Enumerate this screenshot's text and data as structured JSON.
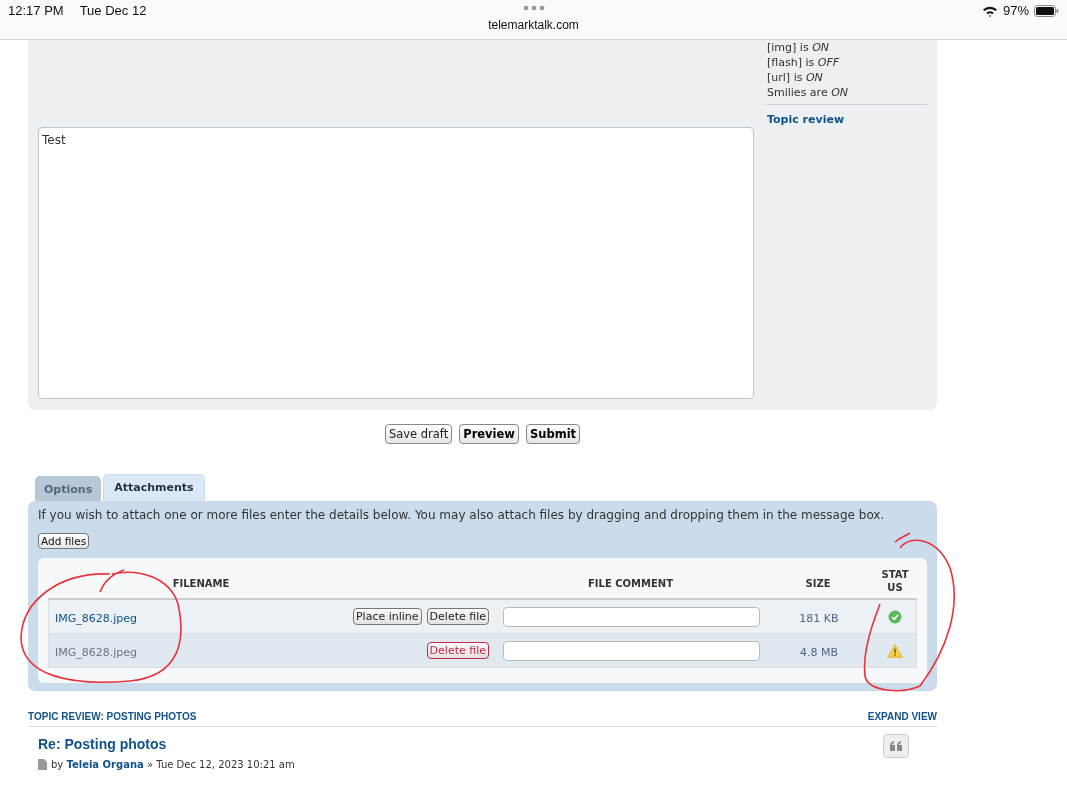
{
  "status_bar": {
    "time": "12:17 PM",
    "date": "Tue Dec 12",
    "url": "telemarktalk.com",
    "battery": "97%"
  },
  "sidebar": {
    "bbcode_lines": [
      "[img] is *ON*",
      "[flash] is *OFF*",
      "[url] is *ON*",
      "Smilies are *ON*"
    ],
    "topic_review_link": "Topic review"
  },
  "message": {
    "value": "Test"
  },
  "form_buttons": [
    {
      "label": "Save draft",
      "primary": false
    },
    {
      "label": "Preview",
      "primary": true
    },
    {
      "label": "Submit",
      "primary": true
    }
  ],
  "tabs": [
    {
      "label": "Options",
      "selected": false
    },
    {
      "label": "Attachments",
      "selected": true
    }
  ],
  "attachments": {
    "intro": "If you wish to attach one or more files enter the details below. You may also attach files by dragging and dropping them in the message box.",
    "add_button": "Add files",
    "columns": [
      "FILENAME",
      "FILE COMMENT",
      "SIZE",
      "STAT US"
    ],
    "rows": [
      {
        "filename": "IMG_8628.jpeg",
        "kind": "ok",
        "buttons": [
          {
            "label": "Place inline",
            "danger": false
          },
          {
            "label": "Delete file",
            "danger": false
          }
        ],
        "size": "181 KB"
      },
      {
        "filename": "IMG_8628.jpeg",
        "kind": "warning",
        "buttons": [
          {
            "label": "Delete file",
            "danger": true
          }
        ],
        "size": "4.8 MB"
      }
    ]
  },
  "topic_review": {
    "heading": "TOPIC REVIEW: POSTING PHOTOS",
    "expand": "EXPAND VIEW",
    "post_title": "Re: Posting photos",
    "by": "by",
    "author": "Teleia Organa",
    "date": "» Tue Dec 12, 2023 10:21 am"
  }
}
